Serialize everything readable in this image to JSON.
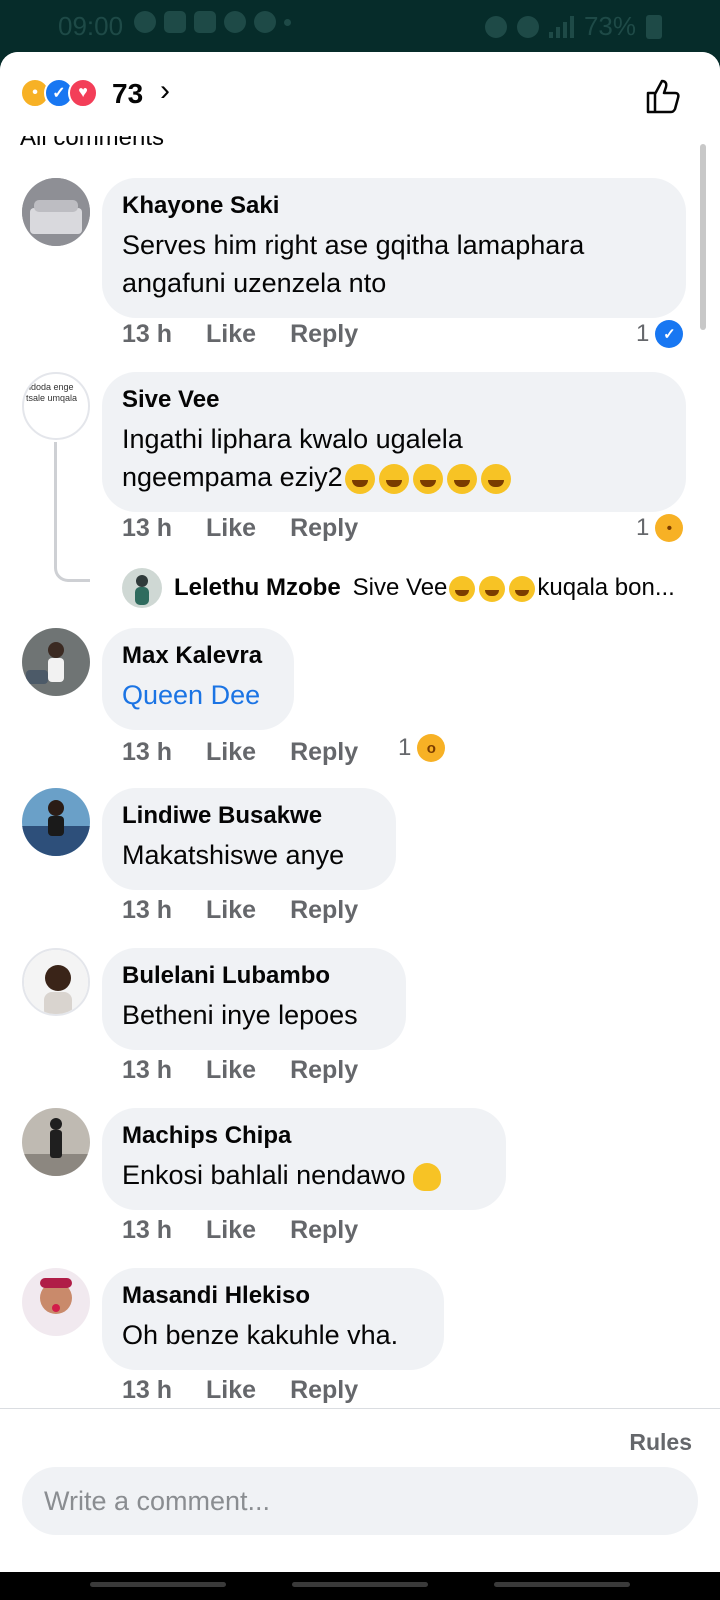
{
  "status_bar": {
    "time": "09:00",
    "battery": "73%"
  },
  "header": {
    "reaction_count": "73",
    "partial_label": "All comments"
  },
  "comments": [
    {
      "author": "Khayone Saki",
      "text_line1": "Serves him right ase gqitha lamaphara",
      "text_line2": "angafuni uzenzela nto",
      "time": "13 h",
      "like": "Like",
      "reply": "Reply",
      "reaction_count": "1",
      "reaction": "like-icon"
    },
    {
      "author": "Sive Vee",
      "text_line1": "Ingathi liphara kwalo ugalela",
      "text_line2": "ngeempama  eziy2",
      "time": "13 h",
      "like": "Like",
      "reply": "Reply",
      "reaction_count": "1",
      "reaction": "haha-icon",
      "avatar_text": "ndoda enge tsale umqala"
    },
    {
      "author": "Max Kalevra",
      "text": "Queen Dee",
      "time": "13 h",
      "like": "Like",
      "reply": "Reply",
      "reaction_count": "1",
      "reaction": "wow-icon"
    },
    {
      "author": "Lindiwe Busakwe",
      "text": "Makatshiswe anye",
      "time": "13 h",
      "like": "Like",
      "reply": "Reply"
    },
    {
      "author": "Bulelani Lubambo",
      "text": "Betheni inye lepoes",
      "time": "13 h",
      "like": "Like",
      "reply": "Reply"
    },
    {
      "author": "Machips Chipa",
      "text": "Enkosi bahlali nendawo",
      "time": "13 h",
      "like": "Like",
      "reply": "Reply"
    },
    {
      "author": "Masandi Hlekiso",
      "text": "Oh benze kakuhle vha.",
      "time": "13 h",
      "like": "Like",
      "reply": "Reply"
    }
  ],
  "reply_preview": {
    "author": "Lelethu Mzobe",
    "text_start": "Sive Vee",
    "text_end": "kuqala bon..."
  },
  "footer": {
    "rules": "Rules",
    "placeholder": "Write a comment..."
  },
  "colors": {
    "accent": "#1877f2",
    "link": "#1b74e4",
    "bubble": "#f0f2f5",
    "status_bar": "#062c2a"
  }
}
